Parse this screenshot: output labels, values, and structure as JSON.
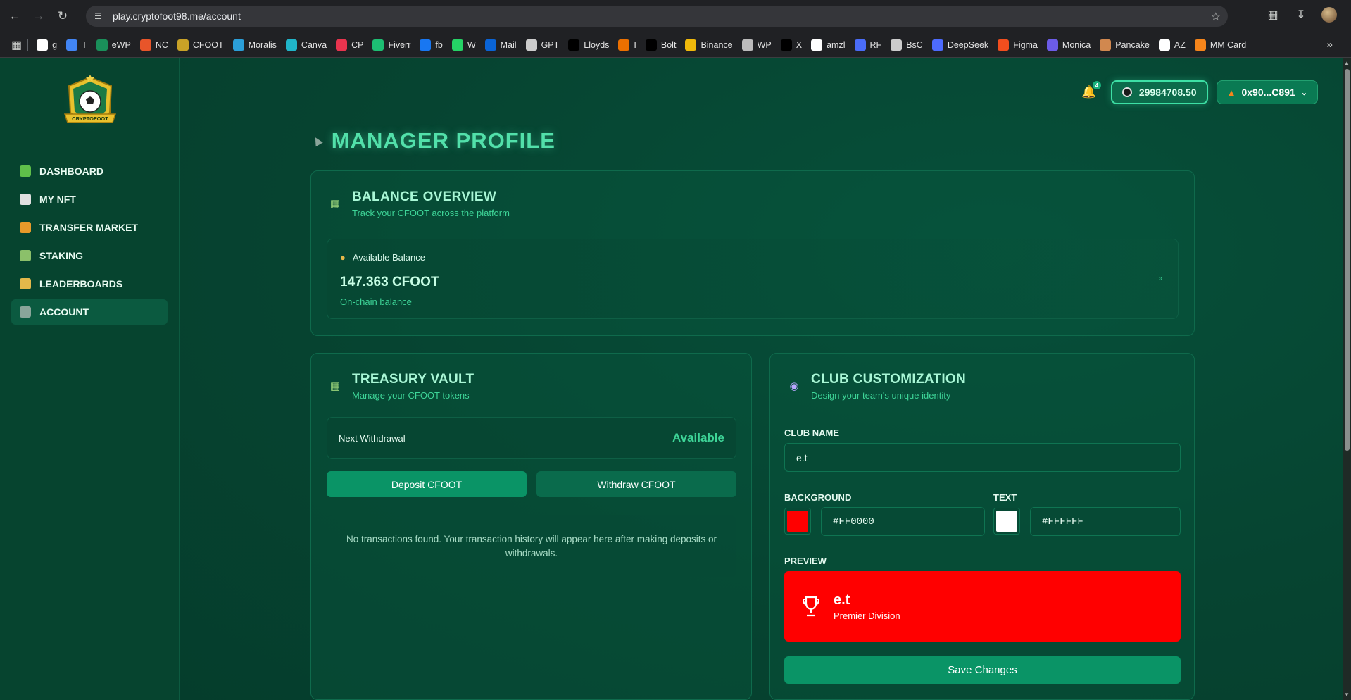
{
  "browser": {
    "url": "play.cryptofoot98.me/account",
    "bookmarks": [
      {
        "label": "g",
        "icon": "google-icon",
        "color": "#ffffff"
      },
      {
        "label": "T",
        "icon": "translate-icon",
        "color": "#4285f4"
      },
      {
        "label": "eWP",
        "icon": "ewp-icon",
        "color": "#1a8f5a"
      },
      {
        "label": "NC",
        "icon": "nc-icon",
        "color": "#e8552a"
      },
      {
        "label": "CFOOT",
        "icon": "cfoot-icon",
        "color": "#c9a227"
      },
      {
        "label": "Moralis",
        "icon": "moralis-icon",
        "color": "#2b9fd9"
      },
      {
        "label": "Canva",
        "icon": "canva-icon",
        "color": "#20b5c9"
      },
      {
        "label": "CP",
        "icon": "cp-icon",
        "color": "#e8344e"
      },
      {
        "label": "Fiverr",
        "icon": "fiverr-icon",
        "color": "#1dbf73"
      },
      {
        "label": "fb",
        "icon": "facebook-icon",
        "color": "#1877f2"
      },
      {
        "label": "W",
        "icon": "whatsapp-icon",
        "color": "#25d366"
      },
      {
        "label": "Mail",
        "icon": "outlook-icon",
        "color": "#0a64d6"
      },
      {
        "label": "GPT",
        "icon": "openai-icon",
        "color": "#cccccc"
      },
      {
        "label": "Lloyds",
        "icon": "lloyds-icon",
        "color": "#000000"
      },
      {
        "label": "I",
        "icon": "itau-icon",
        "color": "#ec7000"
      },
      {
        "label": "Bolt",
        "icon": "bolt-icon",
        "color": "#000000"
      },
      {
        "label": "Binance",
        "icon": "binance-icon",
        "color": "#f0b90b"
      },
      {
        "label": "WP",
        "icon": "stack-icon",
        "color": "#bbbbbb"
      },
      {
        "label": "X",
        "icon": "x-icon",
        "color": "#000000"
      },
      {
        "label": "amzl",
        "icon": "amazon-icon",
        "color": "#ffffff"
      },
      {
        "label": "RF",
        "icon": "rf-icon",
        "color": "#4a6cf7"
      },
      {
        "label": "BsC",
        "icon": "bsc-icon",
        "color": "#cccccc"
      },
      {
        "label": "DeepSeek",
        "icon": "deepseek-icon",
        "color": "#4d6bfe"
      },
      {
        "label": "Figma",
        "icon": "figma-icon",
        "color": "#f24e1e"
      },
      {
        "label": "Monica",
        "icon": "monica-icon",
        "color": "#6c5ce7"
      },
      {
        "label": "Pancake",
        "icon": "pancake-icon",
        "color": "#d1884f"
      },
      {
        "label": "AZ",
        "icon": "amazon-icon",
        "color": "#ffffff"
      },
      {
        "label": "MM Card",
        "icon": "metamask-icon",
        "color": "#f6851b"
      }
    ]
  },
  "sidebar": {
    "logo_text": "CRYPTOFOOT",
    "items": [
      {
        "label": "DASHBOARD",
        "icon": "pitch-icon",
        "active": false
      },
      {
        "label": "MY NFT",
        "icon": "jersey-icon",
        "active": false
      },
      {
        "label": "TRANSFER MARKET",
        "icon": "market-icon",
        "active": false
      },
      {
        "label": "STAKING",
        "icon": "stadium-icon",
        "active": false
      },
      {
        "label": "LEADERBOARDS",
        "icon": "podium-icon",
        "active": false
      },
      {
        "label": "ACCOUNT",
        "icon": "boot-icon",
        "active": true
      }
    ]
  },
  "topbar": {
    "notification_count": "4",
    "balance": "29984708.50",
    "wallet": "0x90...C891"
  },
  "page": {
    "title": "MANAGER PROFILE"
  },
  "balance_overview": {
    "title": "BALANCE OVERVIEW",
    "subtitle": "Track your CFOOT across the platform",
    "available_label": "Available Balance",
    "available_value": "147.363 CFOOT",
    "available_sub": "On-chain balance",
    "arrow": "»"
  },
  "treasury": {
    "title": "TREASURY VAULT",
    "subtitle": "Manage your CFOOT tokens",
    "next_withdrawal_label": "Next Withdrawal",
    "next_withdrawal_value": "Available",
    "deposit_label": "Deposit CFOOT",
    "withdraw_label": "Withdraw CFOOT",
    "empty_message": "No transactions found. Your transaction history will appear here after making deposits or withdrawals."
  },
  "club": {
    "title": "CLUB CUSTOMIZATION",
    "subtitle": "Design your team's unique identity",
    "name_label": "CLUB NAME",
    "name_value": "e.t",
    "background_label": "BACKGROUND",
    "background_value": "#FF0000",
    "text_label": "TEXT",
    "text_value": "#FFFFFF",
    "preview_label": "PREVIEW",
    "preview_name": "e.t",
    "preview_division": "Premier Division",
    "save_label": "Save Changes"
  },
  "colors": {
    "accent": "#3ed598",
    "preview_bg": "#FF0000",
    "preview_text": "#FFFFFF"
  }
}
